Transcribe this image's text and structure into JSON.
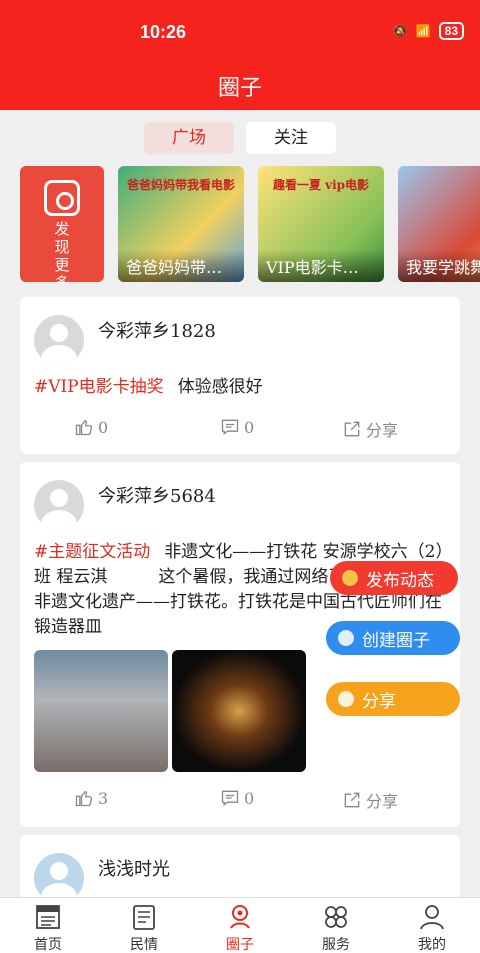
{
  "status_bar": {
    "time": "10:26",
    "battery": "83"
  },
  "header": {
    "title": "圈子"
  },
  "tabs": [
    {
      "label": "广场",
      "active": true
    },
    {
      "label": "关注",
      "active": false
    }
  ],
  "circles": {
    "discover_label": "发现更多",
    "cards": [
      {
        "caption": "爸爸妈妈带…",
        "banner": "爸爸妈妈带我看电影"
      },
      {
        "caption": "VIP电影卡…",
        "banner": "趣看一夏 vip电影"
      },
      {
        "caption": "我要学跳舞",
        "banner": ""
      }
    ]
  },
  "posts": [
    {
      "user": "今彩萍乡1828",
      "tag": "#VIP电影卡抽奖",
      "text": "体验感很好",
      "likes": "0",
      "comments": "0",
      "share": "分享"
    },
    {
      "user": "今彩萍乡5684",
      "tag": "#主题征文活动",
      "text": "非遗文化——打铁花 安源学校六（2）班 程云淇　　　这个暑假，我通过网络了解到了国家级非遗文化遗产——打铁花。打铁花是中国古代匠师们在锻造器皿",
      "likes": "3",
      "comments": "0",
      "share": "分享"
    },
    {
      "user": "浅浅时光"
    }
  ],
  "fabs": {
    "publish": "发布动态",
    "create": "创建圈子",
    "share": "分享"
  },
  "bottom_nav": [
    {
      "label": "首页",
      "icon": "news-icon"
    },
    {
      "label": "民情",
      "icon": "document-icon"
    },
    {
      "label": "圈子",
      "icon": "circle-icon",
      "active": true
    },
    {
      "label": "服务",
      "icon": "grid-icon"
    },
    {
      "label": "我的",
      "icon": "user-icon"
    }
  ],
  "colors": {
    "brand": "#f5231e",
    "accent": "#e52a20"
  }
}
